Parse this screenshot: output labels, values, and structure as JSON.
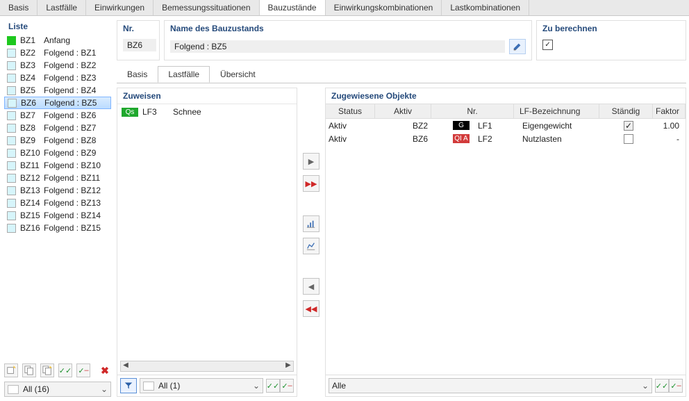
{
  "main_tabs": [
    "Basis",
    "Lastfälle",
    "Einwirkungen",
    "Bemessungssituationen",
    "Bauzustände",
    "Einwirkungskombinationen",
    "Lastkombinationen"
  ],
  "main_tab_active": 4,
  "liste": {
    "title": "Liste",
    "items": [
      {
        "bz": "BZ1",
        "label": "Anfang",
        "green": true
      },
      {
        "bz": "BZ2",
        "label": "Folgend : BZ1"
      },
      {
        "bz": "BZ3",
        "label": "Folgend : BZ2"
      },
      {
        "bz": "BZ4",
        "label": "Folgend : BZ3"
      },
      {
        "bz": "BZ5",
        "label": "Folgend : BZ4"
      },
      {
        "bz": "BZ6",
        "label": "Folgend : BZ5",
        "selected": true
      },
      {
        "bz": "BZ7",
        "label": "Folgend : BZ6"
      },
      {
        "bz": "BZ8",
        "label": "Folgend : BZ7"
      },
      {
        "bz": "BZ9",
        "label": "Folgend : BZ8"
      },
      {
        "bz": "BZ10",
        "label": "Folgend : BZ9"
      },
      {
        "bz": "BZ11",
        "label": "Folgend : BZ10"
      },
      {
        "bz": "BZ12",
        "label": "Folgend : BZ11"
      },
      {
        "bz": "BZ13",
        "label": "Folgend : BZ12"
      },
      {
        "bz": "BZ14",
        "label": "Folgend : BZ13"
      },
      {
        "bz": "BZ15",
        "label": "Folgend : BZ14"
      },
      {
        "bz": "BZ16",
        "label": "Folgend : BZ15"
      }
    ],
    "filter": "All (16)"
  },
  "header": {
    "nr_label": "Nr.",
    "nr_value": "BZ6",
    "name_label": "Name des Bauzustands",
    "name_value": "Folgend : BZ5",
    "calc_label": "Zu berechnen",
    "calc_checked": true
  },
  "sub_tabs": [
    "Basis",
    "Lastfälle",
    "Übersicht"
  ],
  "sub_tab_active": 1,
  "assign": {
    "title": "Zuweisen",
    "rows": [
      {
        "tag": "Qs",
        "tag_class": "qs",
        "lf": "LF3",
        "name": "Schnee"
      }
    ],
    "filter": "All (1)"
  },
  "assigned": {
    "title": "Zugewiesene Objekte",
    "columns": [
      "Status",
      "Aktiv",
      "Nr.",
      "LF-Bezeichnung",
      "Ständig",
      "Faktor"
    ],
    "rows": [
      {
        "status": "Aktiv",
        "aktiv": "BZ2",
        "tag": "G",
        "tag_class": "g",
        "lf": "LF1",
        "lfb": "Eigengewicht",
        "perm": "gray-checked",
        "faktor": "1.00"
      },
      {
        "status": "Aktiv",
        "aktiv": "BZ6",
        "tag": "QI A",
        "tag_class": "qia",
        "lf": "LF2",
        "lfb": "Nutzlasten",
        "perm": "unchecked",
        "faktor": "-"
      }
    ],
    "filter": "Alle"
  },
  "glyphs": {
    "check": "✓",
    "chev": "⌄",
    "right": "▸",
    "left": "◂",
    "dright": "▸▸",
    "dleft": "◂◂",
    "x": "✖"
  }
}
